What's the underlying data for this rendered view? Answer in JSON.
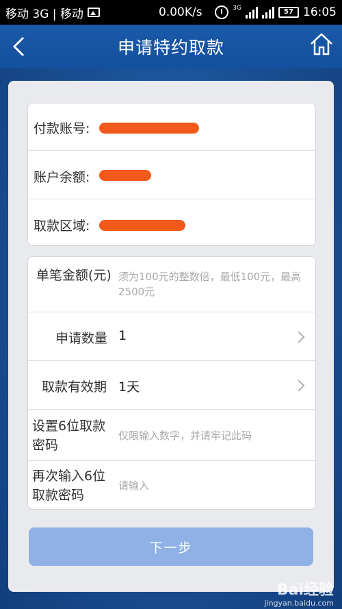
{
  "status_bar": {
    "carrier": "移动 3G | 移动",
    "network_speed": "0.00K/s",
    "network_type": "3G",
    "battery": "57",
    "time": "16:05"
  },
  "header": {
    "title": "申请特约取款",
    "back_icon": "chevron-left-icon",
    "home_icon": "home-icon"
  },
  "account_info": {
    "payment_account_label": "付款账号:",
    "balance_label": "账户余额:",
    "region_label": "取款区域:"
  },
  "form": {
    "amount_label": "单笔金额(元)",
    "amount_placeholder": "须为100元的整数倍，最低100元，最高2500元",
    "quantity_label": "申请数量",
    "quantity_value": "1",
    "validity_label": "取款有效期",
    "validity_value": "1天",
    "password_label": "设置6位取款密码",
    "password_placeholder": "仅限输入数字，并请牢记此码",
    "confirm_label": "再次输入6位取款密码",
    "confirm_placeholder": "请输入"
  },
  "next_button": "下一步",
  "watermark": {
    "logo": "Bai经验",
    "url": "jingyan.baidu.com"
  },
  "colors": {
    "header_bg": "#1a5aa8",
    "button_bg": "#8fb1e6",
    "redaction": "#f25a1c"
  }
}
